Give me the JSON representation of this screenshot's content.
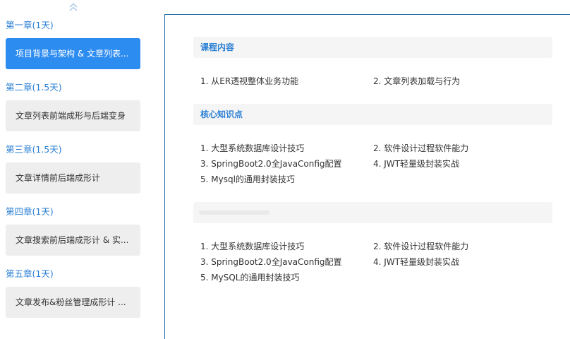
{
  "sidebar": {
    "chapters": [
      {
        "title": "第一章(1天)",
        "lesson": "项目背景与架构 & 文章列表...",
        "active": true
      },
      {
        "title": "第二章(1.5天)",
        "lesson": "文章列表前端成形与后端变身",
        "active": false
      },
      {
        "title": "第三章(1.5天)",
        "lesson": "文章详情前后端成形计",
        "active": false
      },
      {
        "title": "第四章(1天)",
        "lesson": "文章搜索前后端成形计 & 实...",
        "active": false
      },
      {
        "title": "第五章(1天)",
        "lesson": "文章发布&粉丝管理成形计 ...",
        "active": false
      }
    ],
    "scroll_icon": "double-chevron-up-icon"
  },
  "content": {
    "sections": [
      {
        "header": "课程内容",
        "items": [
          "1. 从ER透视整体业务功能",
          "2. 文章列表加载与行为"
        ]
      },
      {
        "header": "核心知识点",
        "items": [
          "1. 大型系统数据库设计技巧",
          "2. 软件设计过程软件能力",
          "3. SpringBoot2.0全JavaConfig配置",
          "4. JWT轻量级封装实战",
          "5. Mysql的通用封装技巧"
        ]
      },
      {
        "header": "",
        "items": [
          "1. 大型系统数据库设计技巧",
          "2. 软件设计过程软件能力",
          "3. SpringBoot2.0全JavaConfig配置",
          "4. JWT轻量级封装实战",
          "5. MySQL的通用封装技巧"
        ]
      }
    ]
  },
  "colors": {
    "accent": "#2d8cf0",
    "chapter_text": "#2a7fd4",
    "panel_border": "#1f6fa8",
    "button_bg": "#eeeeee",
    "header_bg": "#f5f5f5"
  }
}
